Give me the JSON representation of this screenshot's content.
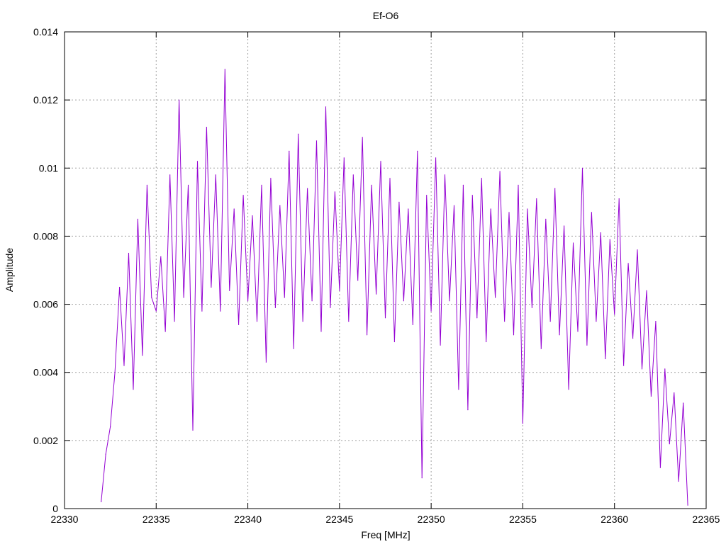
{
  "chart_data": {
    "type": "line",
    "title": "Ef-O6",
    "xlabel": "Freq [MHz]",
    "ylabel": "Amplitude",
    "xlim": [
      22330,
      22365
    ],
    "ylim": [
      0,
      0.014
    ],
    "x_ticks": [
      22330,
      22335,
      22340,
      22345,
      22350,
      22355,
      22360,
      22365
    ],
    "x_tick_labels": [
      "22330",
      "22335",
      "22340",
      "22345",
      "22350",
      "22355",
      "22360",
      "22365"
    ],
    "y_ticks": [
      0,
      0.002,
      0.004,
      0.006,
      0.008,
      0.01,
      0.012,
      0.014
    ],
    "y_tick_labels": [
      "0",
      "0.002",
      "0.004",
      "0.006",
      "0.008",
      "0.01",
      "0.012",
      "0.014"
    ],
    "grid": true,
    "legend": "none",
    "series_color": "#9400d3",
    "series": [
      {
        "x": [
          22332.0,
          22332.25,
          22332.5,
          22332.75,
          22333.0,
          22333.25,
          22333.5,
          22333.75,
          22334.0,
          22334.25,
          22334.5,
          22334.75,
          22335.0,
          22335.25,
          22335.5,
          22335.75,
          22336.0,
          22336.25,
          22336.5,
          22336.75,
          22337.0,
          22337.25,
          22337.5,
          22337.75,
          22338.0,
          22338.25,
          22338.5,
          22338.75,
          22339.0,
          22339.25,
          22339.5,
          22339.75,
          22340.0,
          22340.25,
          22340.5,
          22340.75,
          22341.0,
          22341.25,
          22341.5,
          22341.75,
          22342.0,
          22342.25,
          22342.5,
          22342.75,
          22343.0,
          22343.25,
          22343.5,
          22343.75,
          22344.0,
          22344.25,
          22344.5,
          22344.75,
          22345.0,
          22345.25,
          22345.5,
          22345.75,
          22346.0,
          22346.25,
          22346.5,
          22346.75,
          22347.0,
          22347.25,
          22347.5,
          22347.75,
          22348.0,
          22348.25,
          22348.5,
          22348.75,
          22349.0,
          22349.25,
          22349.5,
          22349.75,
          22350.0,
          22350.25,
          22350.5,
          22350.75,
          22351.0,
          22351.25,
          22351.5,
          22351.75,
          22352.0,
          22352.25,
          22352.5,
          22352.75,
          22353.0,
          22353.25,
          22353.5,
          22353.75,
          22354.0,
          22354.25,
          22354.5,
          22354.75,
          22355.0,
          22355.25,
          22355.5,
          22355.75,
          22356.0,
          22356.25,
          22356.5,
          22356.75,
          22357.0,
          22357.25,
          22357.5,
          22357.75,
          22358.0,
          22358.25,
          22358.5,
          22358.75,
          22359.0,
          22359.25,
          22359.5,
          22359.75,
          22360.0,
          22360.25,
          22360.5,
          22360.75,
          22361.0,
          22361.25,
          22361.5,
          22361.75,
          22362.0,
          22362.25,
          22362.5,
          22362.75,
          22363.0,
          22363.25,
          22363.5,
          22363.75,
          22364.0
        ],
        "values": [
          0.0002,
          0.0016,
          0.0024,
          0.004,
          0.0065,
          0.0042,
          0.0075,
          0.0035,
          0.0085,
          0.0045,
          0.0095,
          0.0062,
          0.0058,
          0.0074,
          0.0052,
          0.0098,
          0.0055,
          0.012,
          0.0062,
          0.0095,
          0.0023,
          0.0102,
          0.0058,
          0.0112,
          0.0065,
          0.0098,
          0.0058,
          0.0129,
          0.0064,
          0.0088,
          0.0054,
          0.0092,
          0.0061,
          0.0086,
          0.0055,
          0.0095,
          0.0043,
          0.0097,
          0.0059,
          0.0089,
          0.0062,
          0.0105,
          0.0047,
          0.011,
          0.0055,
          0.0094,
          0.0061,
          0.0108,
          0.0052,
          0.0118,
          0.0059,
          0.0093,
          0.0064,
          0.0103,
          0.0055,
          0.0098,
          0.0067,
          0.0109,
          0.0051,
          0.0095,
          0.0063,
          0.0102,
          0.0056,
          0.0097,
          0.0049,
          0.009,
          0.0061,
          0.0088,
          0.0054,
          0.0105,
          0.0009,
          0.0092,
          0.0058,
          0.0103,
          0.0048,
          0.0098,
          0.0061,
          0.0089,
          0.0035,
          0.0095,
          0.0029,
          0.0092,
          0.0056,
          0.0097,
          0.0049,
          0.0088,
          0.0062,
          0.0099,
          0.0055,
          0.0087,
          0.0051,
          0.0095,
          0.0025,
          0.0088,
          0.0059,
          0.0091,
          0.0047,
          0.0085,
          0.0055,
          0.0094,
          0.0051,
          0.0083,
          0.0035,
          0.0078,
          0.0052,
          0.01,
          0.0048,
          0.0087,
          0.0055,
          0.0081,
          0.0044,
          0.0079,
          0.0057,
          0.0091,
          0.0042,
          0.0072,
          0.005,
          0.0076,
          0.0041,
          0.0064,
          0.0033,
          0.0055,
          0.0012,
          0.0041,
          0.0019,
          0.0034,
          0.0008,
          0.0031,
          0.0001
        ]
      }
    ]
  }
}
